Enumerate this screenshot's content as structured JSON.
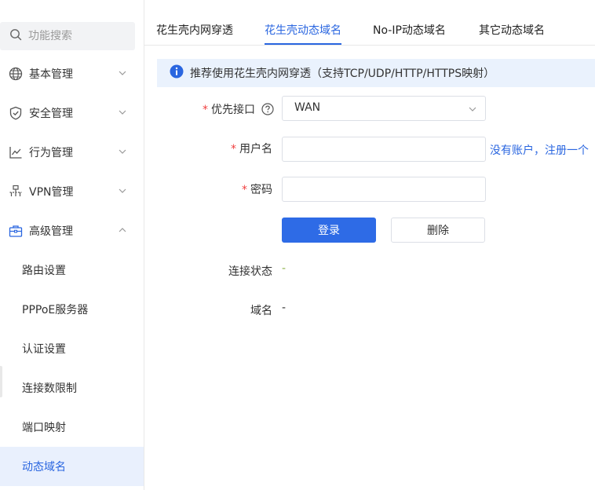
{
  "search": {
    "placeholder": "功能搜索"
  },
  "sidebar": {
    "menus": [
      {
        "label": "基本管理",
        "icon": "globe-icon",
        "expanded": false
      },
      {
        "label": "安全管理",
        "icon": "shield-icon",
        "expanded": false
      },
      {
        "label": "行为管理",
        "icon": "chart-line-icon",
        "expanded": false
      },
      {
        "label": "VPN管理",
        "icon": "network-icon",
        "expanded": false
      },
      {
        "label": "高级管理",
        "icon": "toolbox-icon",
        "expanded": true
      }
    ],
    "sub_items": [
      {
        "label": "路由设置",
        "active": false
      },
      {
        "label": "PPPoE服务器",
        "active": false
      },
      {
        "label": "认证设置",
        "active": false
      },
      {
        "label": "连接数限制",
        "active": false
      },
      {
        "label": "端口映射",
        "active": false
      },
      {
        "label": "动态域名",
        "active": true
      }
    ]
  },
  "tabs": [
    {
      "label": "花生壳内网穿透",
      "active": false
    },
    {
      "label": "花生壳动态域名",
      "active": true
    },
    {
      "label": "No-IP动态域名",
      "active": false
    },
    {
      "label": "其它动态域名",
      "active": false
    }
  ],
  "notice": {
    "text": "推荐使用花生壳内网穿透（支持TCP/UDP/HTTP/HTTPS映射）",
    "icon": "info-icon"
  },
  "form": {
    "interface": {
      "label": "优先接口",
      "required": "*",
      "value": "WAN",
      "help_icon": "question-icon"
    },
    "username": {
      "label": "用户名",
      "required": "*",
      "value": "",
      "link": "没有账户，注册一个"
    },
    "password": {
      "label": "密码",
      "required": "*",
      "value": ""
    },
    "login_button": "登录",
    "delete_button": "删除",
    "status": {
      "label": "连接状态",
      "value": "-"
    },
    "domain": {
      "label": "域名",
      "value": "-"
    }
  },
  "colors": {
    "accent": "#2a66e0",
    "primary_button": "#2e6be6",
    "active_bg": "#e9f0fd",
    "notice_bg": "#eaf2fd",
    "required": "#f04040"
  }
}
